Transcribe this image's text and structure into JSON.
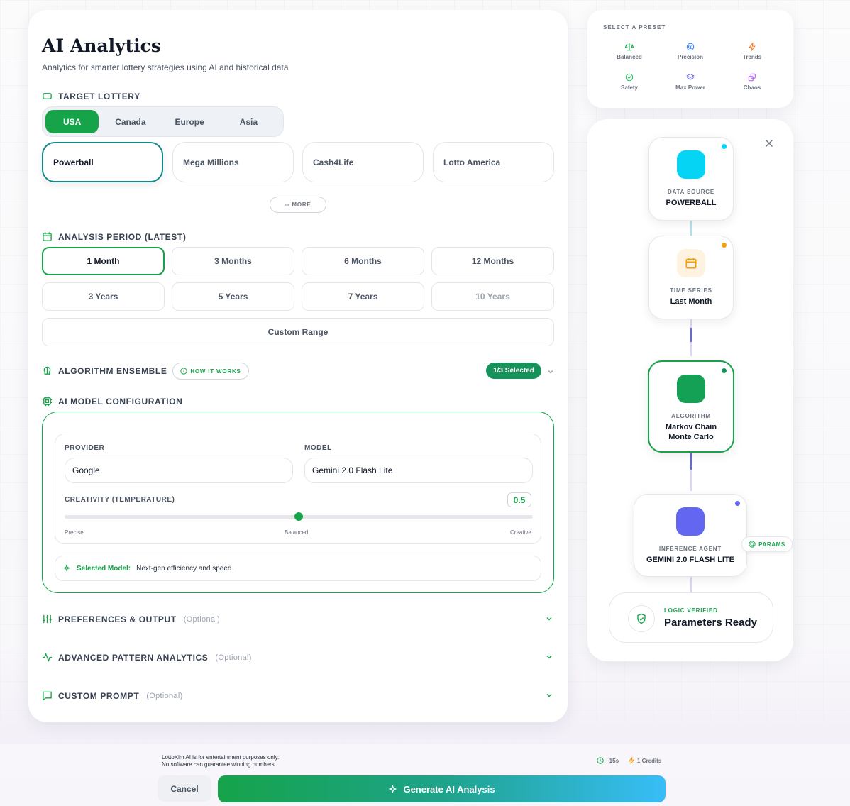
{
  "header": {
    "title": "AI Analytics",
    "subtitle": "Analytics for smarter lottery strategies using AI and historical data"
  },
  "target_lottery": {
    "label": "TARGET LOTTERY",
    "regions": [
      "USA",
      "Canada",
      "Europe",
      "Asia"
    ],
    "selected_region": "USA",
    "lotteries": [
      "Powerball",
      "Mega Millions",
      "Cash4Life",
      "Lotto America"
    ],
    "selected_lottery": "Powerball",
    "more_label": "-- MORE"
  },
  "analysis_period": {
    "label": "ANALYSIS PERIOD (LATEST)",
    "options": [
      "1 Month",
      "3 Months",
      "6 Months",
      "12 Months",
      "3 Years",
      "5 Years",
      "7 Years",
      "10 Years"
    ],
    "selected": "1 Month",
    "custom_label": "Custom Range"
  },
  "algorithm": {
    "label": "ALGORITHM ENSEMBLE",
    "how_label": "HOW IT WORKS",
    "selected_badge": "1/3 Selected"
  },
  "model_config": {
    "label": "AI MODEL CONFIGURATION",
    "provider_label": "PROVIDER",
    "provider_value": "Google",
    "model_label": "MODEL",
    "model_value": "Gemini 2.0 Flash Lite",
    "temperature_label": "CREATIVITY (TEMPERATURE)",
    "temperature_value": "0.5",
    "temperature_fraction": 0.5,
    "tick_low": "Precise",
    "tick_mid": "Balanced",
    "tick_high": "Creative",
    "selected_model_label": "Selected Model:",
    "selected_model_desc": "Next-gen efficiency and speed."
  },
  "sections": {
    "preferences": "PREFERENCES & OUTPUT",
    "advanced": "ADVANCED PATTERN ANALYTICS",
    "custom_prompt": "CUSTOM PROMPT",
    "optional": "(Optional)"
  },
  "presets": {
    "title": "SELECT A PRESET",
    "items": [
      "Balanced",
      "Precision",
      "Trends",
      "Safety",
      "Max Power",
      "Chaos"
    ]
  },
  "pipeline": {
    "source_label": "DATA SOURCE",
    "source_value": "POWERBALL",
    "time_label": "TIME SERIES",
    "time_value": "Last Month",
    "algo_label": "ALGORITHM",
    "algo_value": "Markov Chain Monte Carlo",
    "agent_label": "INFERENCE AGENT",
    "agent_value": "GEMINI 2.0 FLASH LITE",
    "params_label": "PARAMS",
    "verified_label": "LOGIC VERIFIED",
    "verified_value": "Parameters Ready"
  },
  "footer": {
    "disclaimer_1": "LottoKim AI is for entertainment purposes only.",
    "disclaimer_2": "No software can guarantee winning numbers.",
    "time_est": "~15s",
    "credits": "1 Credits",
    "cancel_label": "Cancel",
    "generate_label": "Generate AI Analysis"
  },
  "colors": {
    "accent": "#16a34a",
    "teal": "#16888a",
    "source": "#06d4f5",
    "time_series": "#f59e0b",
    "algorithm": "#16a34a",
    "agent": "#6366f1"
  }
}
